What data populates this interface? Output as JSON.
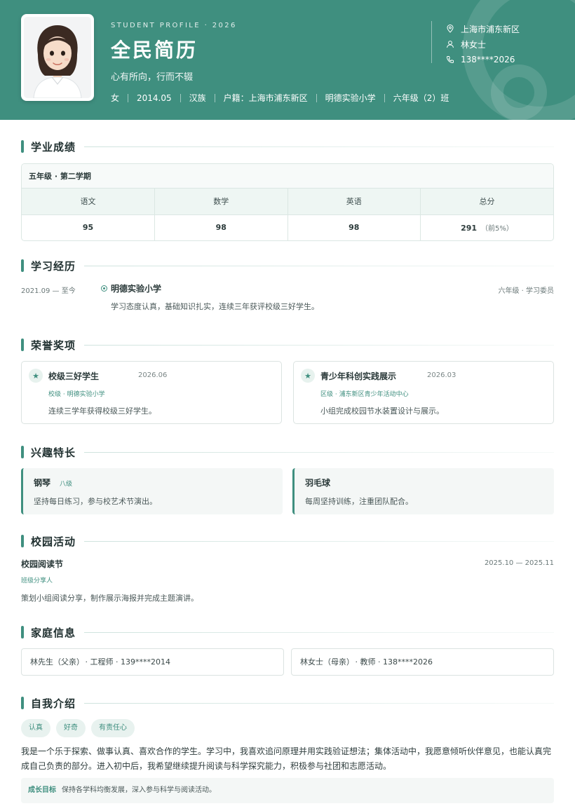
{
  "header": {
    "tag": "STUDENT PROFILE · 2026",
    "name": "全民简历",
    "motto": "心有所向，行而不辍",
    "meta": [
      "女",
      "2014.05",
      "汉族",
      "户籍：上海市浦东新区",
      "明德实验小学",
      "六年级（2）班"
    ],
    "contact": {
      "location": "上海市浦东新区",
      "guardian": "林女士",
      "phone": "138****2026"
    },
    "photo_icon": "student-photo"
  },
  "sections": {
    "grades": "学业成绩",
    "education": "学习经历",
    "honors": "荣誉奖项",
    "interests": "兴趣特长",
    "activities": "校园活动",
    "family": "家庭信息",
    "intro": "自我介绍"
  },
  "grades": {
    "term": "五年级 · 第二学期",
    "headers": [
      "语文",
      "数学",
      "英语",
      "总分"
    ],
    "values": [
      "95",
      "98",
      "98",
      "291"
    ],
    "rank": "（前5%）"
  },
  "education": {
    "period": "2021.09 — 至今",
    "school": "明德实验小学",
    "role": "六年级 · 学习委员",
    "desc": "学习态度认真，基础知识扎实，连续三年获评校级三好学生。"
  },
  "honors": [
    {
      "name": "校级三好学生",
      "date": "2026.06",
      "org": "校级 · 明德实验小学",
      "desc": "连续三学年获得校级三好学生。"
    },
    {
      "name": "青少年科创实践展示",
      "date": "2026.03",
      "org": "区级 · 浦东新区青少年活动中心",
      "desc": "小组完成校园节水装置设计与展示。"
    }
  ],
  "interests": [
    {
      "name": "钢琴",
      "level": "八级",
      "desc": "坚持每日练习，参与校艺术节演出。"
    },
    {
      "name": "羽毛球",
      "level": "",
      "desc": "每周坚持训练，注重团队配合。"
    }
  ],
  "activity": {
    "name": "校园阅读节",
    "period": "2025.10 — 2025.11",
    "role": "班级分享人",
    "desc": "策划小组阅读分享，制作展示海报并完成主题演讲。"
  },
  "family": [
    {
      "name": "林先生（父亲）",
      "rest": "· 工程师 · 139****2014"
    },
    {
      "name": "林女士（母亲）",
      "rest": "· 教师 · 138****2026"
    }
  ],
  "intro": {
    "tags": [
      "认真",
      "好奇",
      "有责任心"
    ],
    "text": "我是一个乐于探索、做事认真、喜欢合作的学生。学习中，我喜欢追问原理并用实践验证想法；集体活动中，我愿意倾听伙伴意见，也能认真完成自己负责的部分。进入初中后，我希望继续提升阅读与科学探究能力，积极参与社团和志愿活动。",
    "goal_label": "成长目标",
    "goal_text": "保持各学科均衡发展，深入参与科学与阅读活动。"
  },
  "colors": {
    "accent": "#3f8f7f",
    "header_bg": "#3f8f7f",
    "tag_bg": "#e8f2ef"
  }
}
